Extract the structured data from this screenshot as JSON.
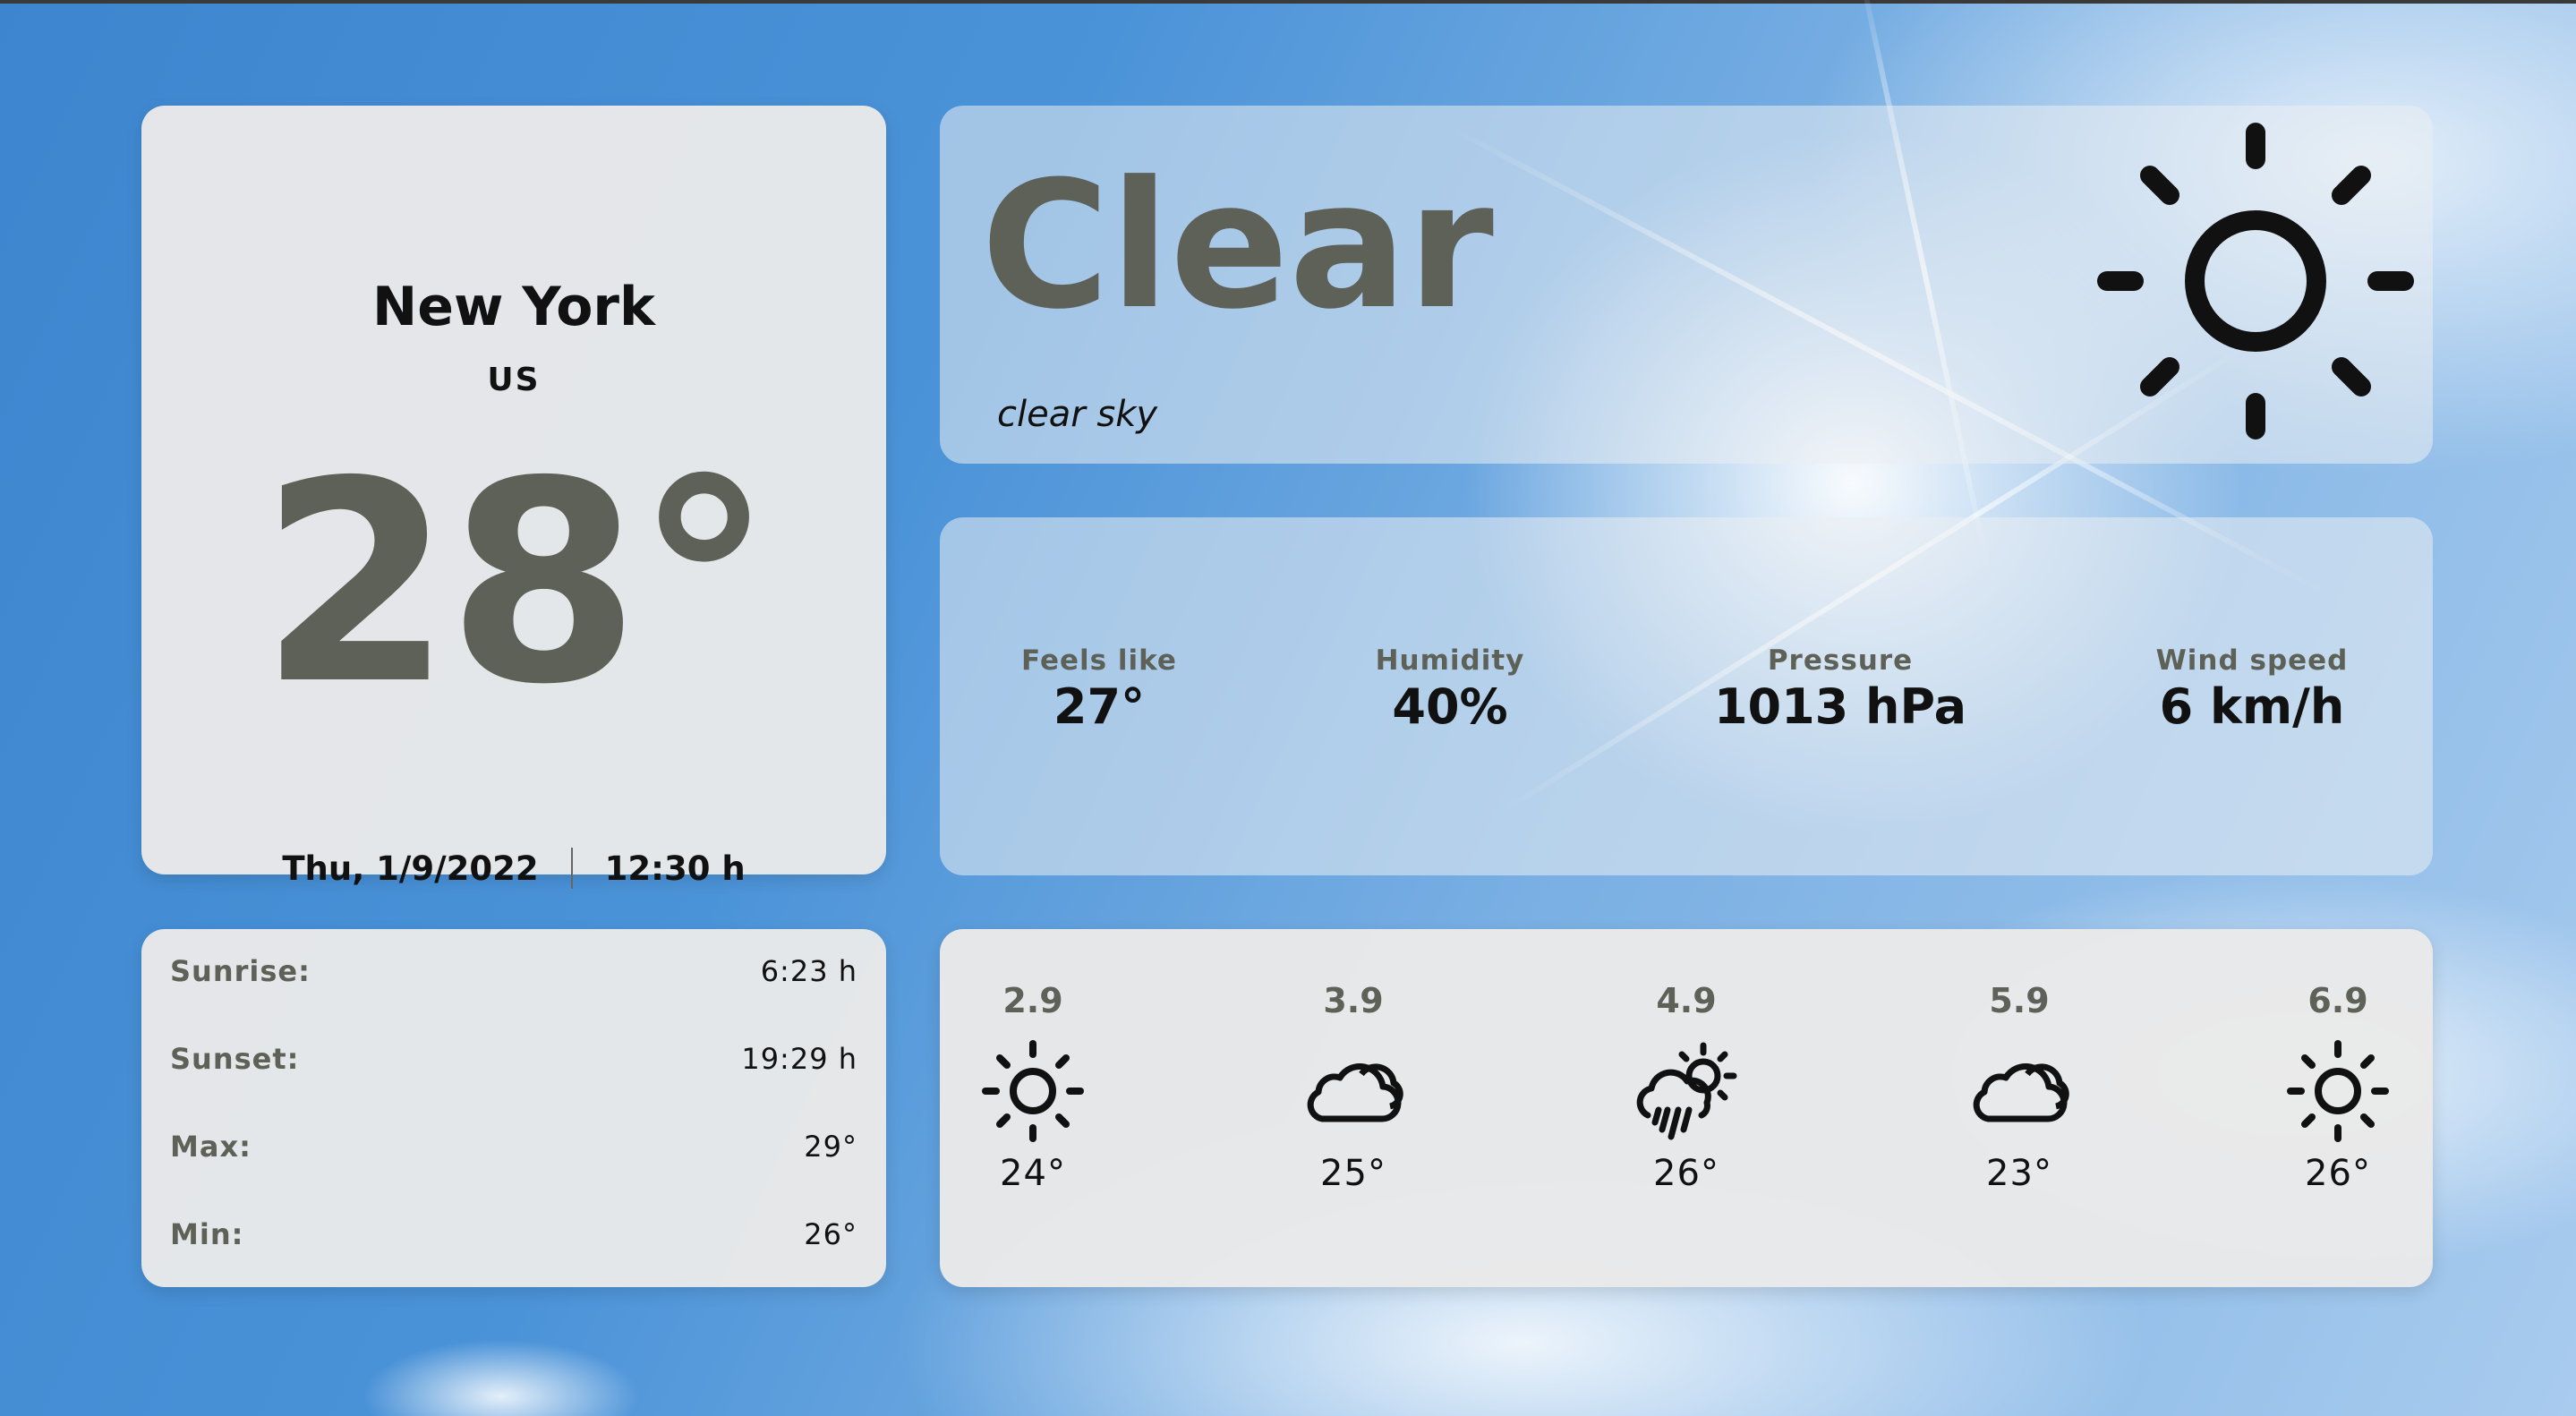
{
  "location": {
    "city": "New York",
    "country": "US"
  },
  "current": {
    "temperature": "28°",
    "date": "Thu, 1/9/2022",
    "time": "12:30 h",
    "condition": "Clear",
    "description": "clear sky",
    "icon": "sun-icon"
  },
  "stats": [
    {
      "label": "Feels like",
      "value": "27°"
    },
    {
      "label": "Humidity",
      "value": "40%"
    },
    {
      "label": "Pressure",
      "value": "1013 hPa"
    },
    {
      "label": "Wind speed",
      "value": "6 km/h"
    }
  ],
  "sun": [
    {
      "label": "Sunrise:",
      "value": "6:23 h"
    },
    {
      "label": "Sunset:",
      "value": "19:29 h"
    },
    {
      "label": "Max:",
      "value": "29°"
    },
    {
      "label": "Min:",
      "value": "26°"
    }
  ],
  "forecast": [
    {
      "time": "2.9",
      "icon": "sun-icon",
      "temp": "24°"
    },
    {
      "time": "3.9",
      "icon": "cloud-icon",
      "temp": "25°"
    },
    {
      "time": "4.9",
      "icon": "rain-sun-cloud-icon",
      "temp": "26°"
    },
    {
      "time": "5.9",
      "icon": "cloud-icon",
      "temp": "23°"
    },
    {
      "time": "6.9",
      "icon": "sun-icon",
      "temp": "26°"
    }
  ],
  "colors": {
    "accent_gray": "#5e6157",
    "text_dark": "#111111",
    "card_bg": "#e9e9e9",
    "sky_blue": "#4b93d8"
  }
}
